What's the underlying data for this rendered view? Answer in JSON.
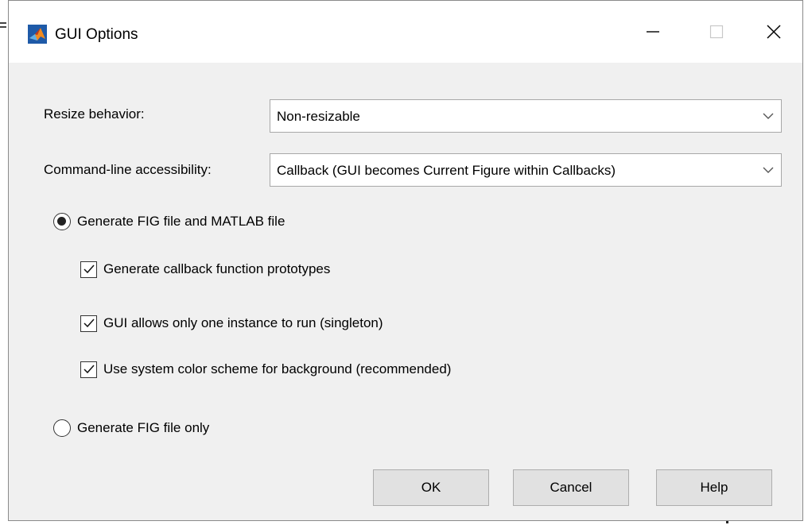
{
  "window": {
    "title": "GUI Options",
    "app_icon": "matlab-icon",
    "controls": {
      "minimize_icon": "minimize-icon",
      "maximize_icon": "maximize-icon",
      "close_icon": "close-icon"
    }
  },
  "form": {
    "resize": {
      "label": "Resize behavior:",
      "selected": "Non-resizable"
    },
    "accessibility": {
      "label": "Command-line accessibility:",
      "selected": "Callback (GUI becomes Current Figure within Callbacks)"
    },
    "generation": {
      "option_fig_and_matlab": {
        "label": "Generate FIG file and MATLAB file",
        "selected": true
      },
      "sub_options": [
        {
          "label": "Generate callback function prototypes",
          "checked": true
        },
        {
          "label": "GUI allows only one instance to run (singleton)",
          "checked": true
        },
        {
          "label": "Use system color scheme for background (recommended)",
          "checked": true
        }
      ],
      "option_fig_only": {
        "label": "Generate FIG file only",
        "selected": false
      }
    }
  },
  "buttons": {
    "ok": "OK",
    "cancel": "Cancel",
    "help": "Help"
  },
  "colors": {
    "dialog_bg": "#f0f0f0",
    "titlebar_bg": "#ffffff",
    "button_bg": "#e1e1e1"
  }
}
